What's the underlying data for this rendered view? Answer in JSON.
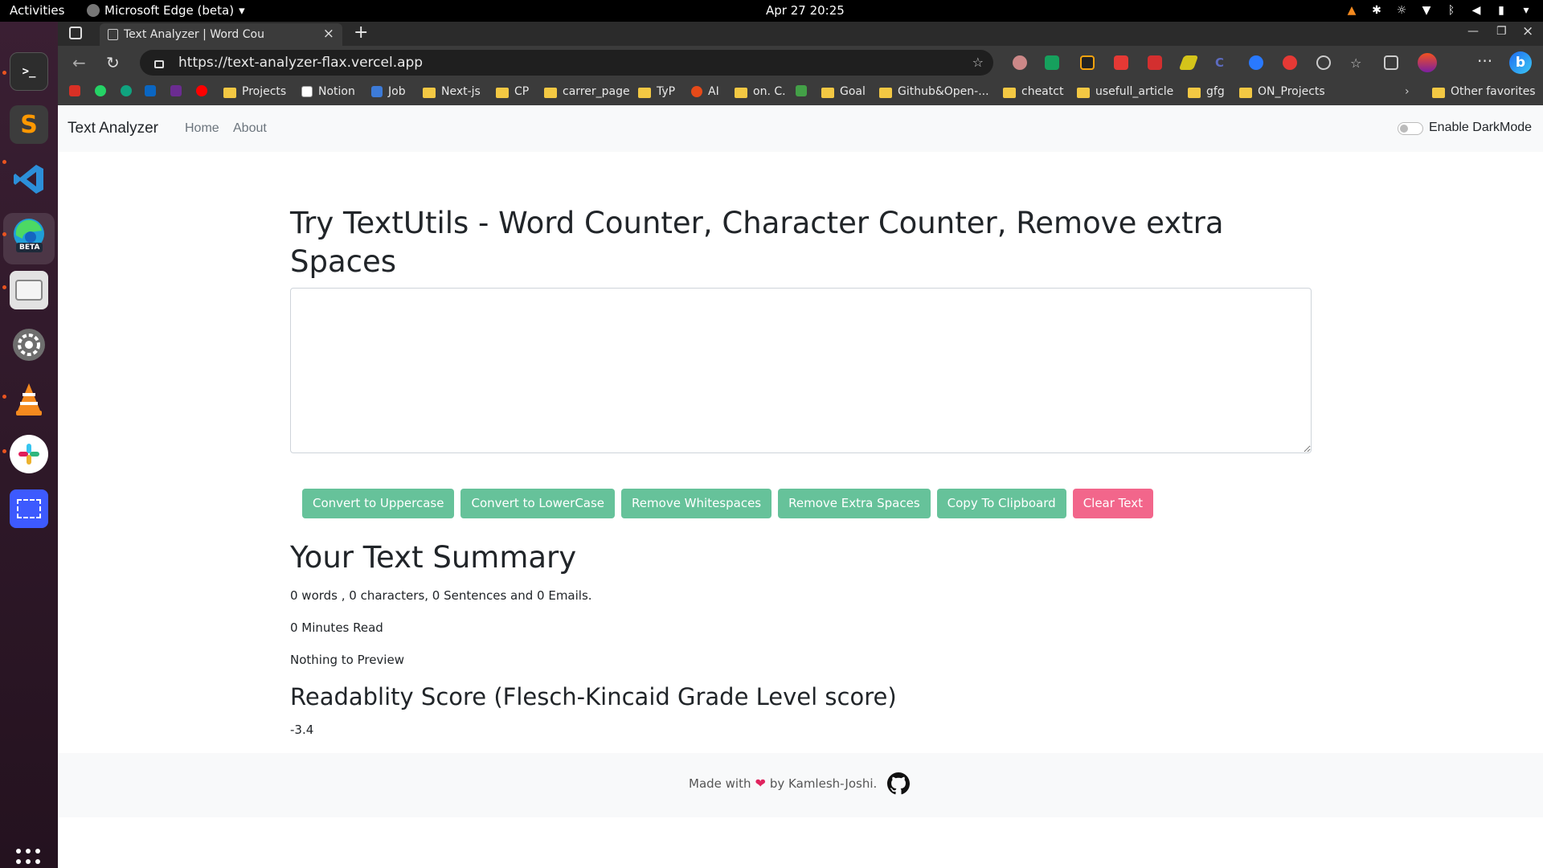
{
  "system_bar": {
    "activities": "Activities",
    "app_name": "Microsoft Edge (beta)",
    "clock": "Apr 27  20:25"
  },
  "dock": {
    "apps": [
      "terminal-icon",
      "sublime-text-icon",
      "vscode-icon",
      "edge-beta-icon",
      "files-icon",
      "settings-icon",
      "vlc-icon",
      "slack-icon",
      "screenshot-icon"
    ],
    "edge_badge": "BETA",
    "terminal_glyph": ">_"
  },
  "browser": {
    "tab_title": "Text Analyzer | Word Cou",
    "url": "https://text-analyzer-flax.vercel.app",
    "favorites": [
      {
        "label": "Projects",
        "type": "folder"
      },
      {
        "label": "Notion",
        "type": "link"
      },
      {
        "label": "Job",
        "type": "link"
      },
      {
        "label": "Next-js",
        "type": "folder"
      },
      {
        "label": "CP",
        "type": "folder"
      },
      {
        "label": "carrer_page",
        "type": "folder"
      },
      {
        "label": "TyP",
        "type": "folder"
      },
      {
        "label": "AI",
        "type": "link"
      },
      {
        "label": "on. C.",
        "type": "folder"
      },
      {
        "label": "Goal",
        "type": "folder"
      },
      {
        "label": "Github&Open-...",
        "type": "folder"
      },
      {
        "label": "cheatct",
        "type": "folder"
      },
      {
        "label": "usefull_article",
        "type": "folder"
      },
      {
        "label": "gfg",
        "type": "folder"
      },
      {
        "label": "ON_Projects",
        "type": "folder"
      }
    ],
    "other_favorites": "Other favorites",
    "bing_letter": "b",
    "colors": {
      "tab_strip": "#2b2b2b",
      "toolbar": "#3b3b3b",
      "folder": "#f3c843"
    }
  },
  "navbar": {
    "brand": "Text Analyzer",
    "links": [
      "Home",
      "About"
    ],
    "dark_mode_label": "Enable DarkMode",
    "dark_mode_enabled": false
  },
  "main": {
    "heading": "Try TextUtils - Word Counter, Character Counter, Remove extra Spaces",
    "textarea_value": "",
    "buttons": [
      {
        "label": "Convert to Uppercase",
        "color": "#66c29a"
      },
      {
        "label": "Convert to LowerCase",
        "color": "#66c29a"
      },
      {
        "label": "Remove Whitespaces",
        "color": "#66c29a"
      },
      {
        "label": "Remove Extra Spaces",
        "color": "#66c29a"
      },
      {
        "label": "Copy To Clipboard",
        "color": "#66c29a"
      },
      {
        "label": "Clear Text",
        "color": "#f2668b"
      }
    ],
    "summary_title": "Your Text Summary",
    "summary_counts": "0 words , 0 characters, 0 Sentences and 0 Emails.",
    "minutes_read": "0 Minutes Read",
    "preview": "Nothing to Preview",
    "readability_title": "Readablity Score (Flesch-Kincaid Grade Level score)",
    "readability_value": "-3.4"
  },
  "footer": {
    "prefix": "Made with",
    "heart": "❤",
    "suffix": "by Kamlesh-Joshi."
  }
}
